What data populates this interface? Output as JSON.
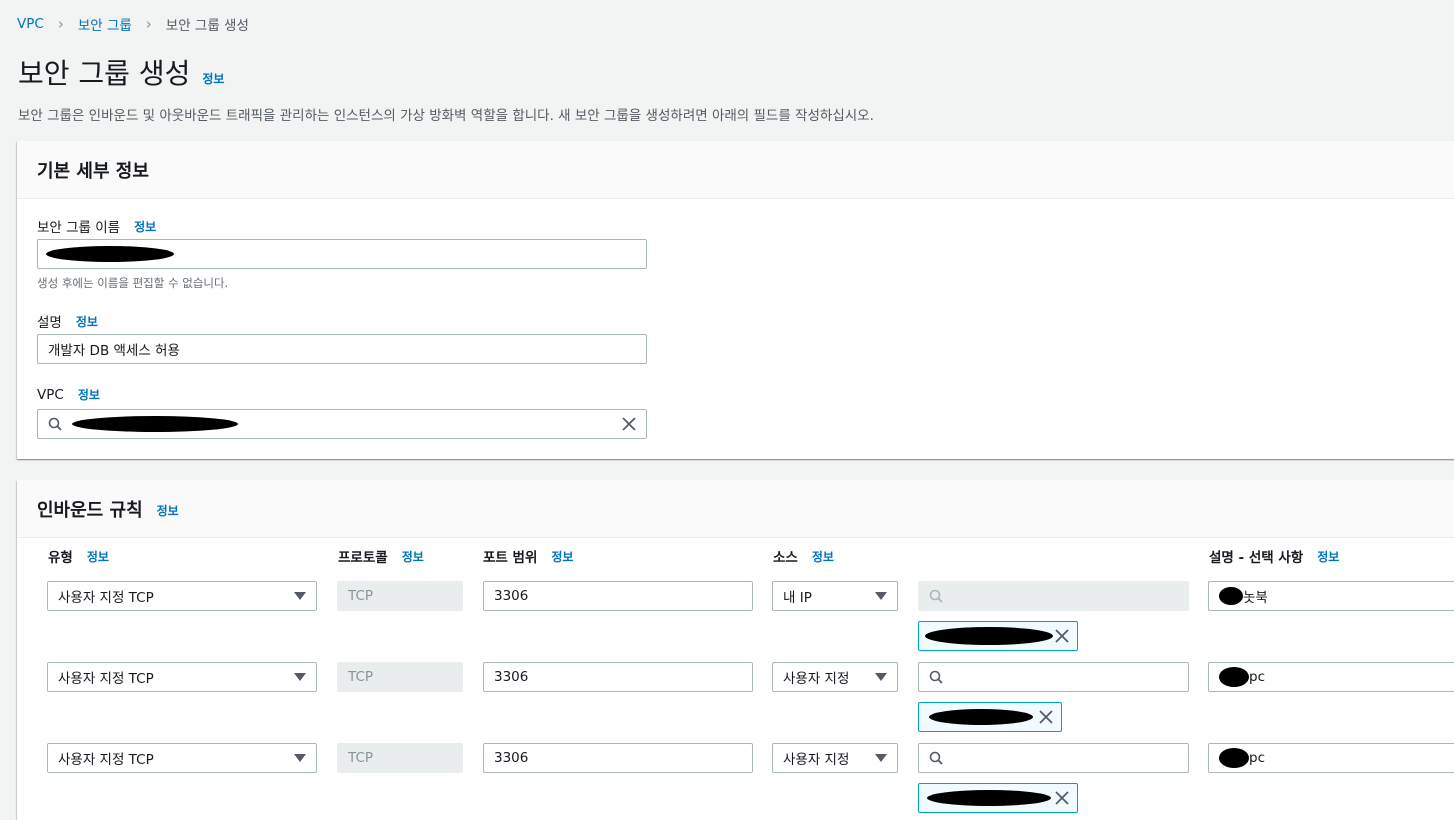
{
  "breadcrumb": {
    "items": [
      "VPC",
      "보안 그룹"
    ],
    "current": "보안 그룹 생성"
  },
  "page": {
    "title": "보안 그룹 생성",
    "info": "정보",
    "description": "보안 그룹은 인바운드 및 아웃바운드 트래픽을 관리하는 인스턴스의 가상 방화벽 역할을 합니다. 새 보안 그룹을 생성하려면 아래의 필드를 작성하십시오."
  },
  "basic": {
    "heading": "기본 세부 정보",
    "name_label": "보안 그룹 이름",
    "name_hint": "생성 후에는 이름을 편집할 수 없습니다.",
    "desc_label": "설명",
    "desc_value": "개발자 DB 액세스 허용",
    "vpc_label": "VPC",
    "info": "정보"
  },
  "inbound": {
    "heading": "인바운드 규칙",
    "info": "정보",
    "columns": [
      "유형",
      "프로토콜",
      "포트 범위",
      "소스",
      "설명 - 선택 사항"
    ],
    "rules": [
      {
        "type": "사용자 지정 TCP",
        "protocol": "TCP",
        "port": "3306",
        "source": "내 IP",
        "description": "놋북"
      },
      {
        "type": "사용자 지정 TCP",
        "protocol": "TCP",
        "port": "3306",
        "source": "사용자 지정",
        "description": "pc"
      },
      {
        "type": "사용자 지정 TCP",
        "protocol": "TCP",
        "port": "3306",
        "source": "사용자 지정",
        "description": "pc"
      }
    ]
  },
  "colors": {
    "link": "#0073bb",
    "token_border": "#00a1c9",
    "background": "#f2f3f3"
  }
}
